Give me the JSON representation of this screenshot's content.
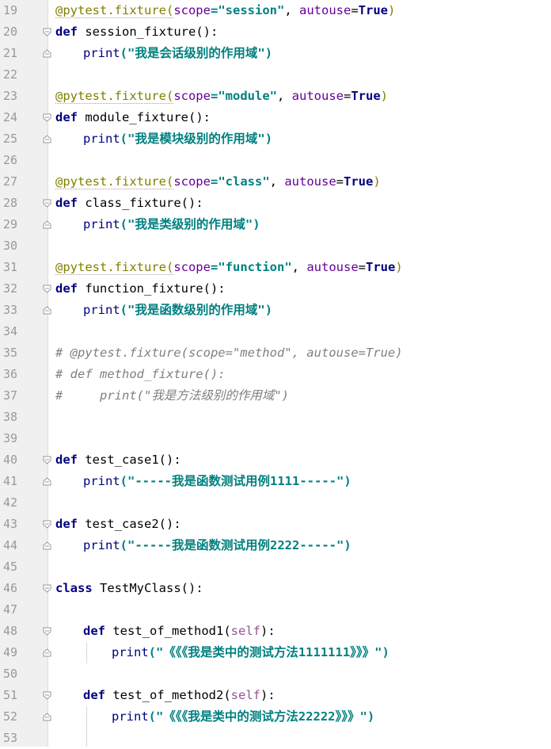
{
  "editor": {
    "line_numbers": [
      "19",
      "20",
      "21",
      "22",
      "23",
      "24",
      "25",
      "26",
      "27",
      "28",
      "29",
      "30",
      "31",
      "32",
      "33",
      "34",
      "35",
      "36",
      "37",
      "38",
      "39",
      "40",
      "41",
      "42",
      "43",
      "44",
      "45",
      "46",
      "47",
      "48",
      "49",
      "50",
      "51",
      "52",
      "53"
    ],
    "tokens": {
      "dec_prefix": "@pytest.fixture(",
      "scope_kw": "scope",
      "eq_quote": "=\"",
      "close_quote": "\"",
      "comma_sp": ", ",
      "autouse_kw": "autouse",
      "eq": "=",
      "true_kw": "True",
      "close_paren": ")",
      "def_kw": "def",
      "class_kw": "class",
      "print_fn": "print",
      "open_print": "(\"",
      "close_print": "\")",
      "parens_colon": "():",
      "self_open": "(",
      "self_kw": "self",
      "self_close": "):"
    },
    "scopes": {
      "session": "session",
      "module": "module",
      "class": "class",
      "function": "function"
    },
    "functions": {
      "session": " session_fixture",
      "module": " module_fixture",
      "class": " class_fixture",
      "function": " function_fixture",
      "case1": " test_case1",
      "case2": " test_case2",
      "method1": " test_of_method1",
      "method2": " test_of_method2"
    },
    "class_name": " TestMyClass",
    "messages": {
      "session": "我是会话级别的作用域",
      "module": "我是模块级别的作用域",
      "class": "我是类级别的作用域",
      "function": "我是函数级别的作用域",
      "case1": "-----我是函数测试用例1111-----",
      "case2": "-----我是函数测试用例2222-----",
      "method1": "《《《我是类中的测试方法1111111》》》",
      "method2": "《《《我是类中的测试方法22222》》》"
    },
    "comments": {
      "c35": "# @pytest.fixture(scope=\"method\", autouse=True)",
      "c36": "# def method_fixture():",
      "c37": "#     print(\"我是方法级别的作用域\")"
    }
  }
}
